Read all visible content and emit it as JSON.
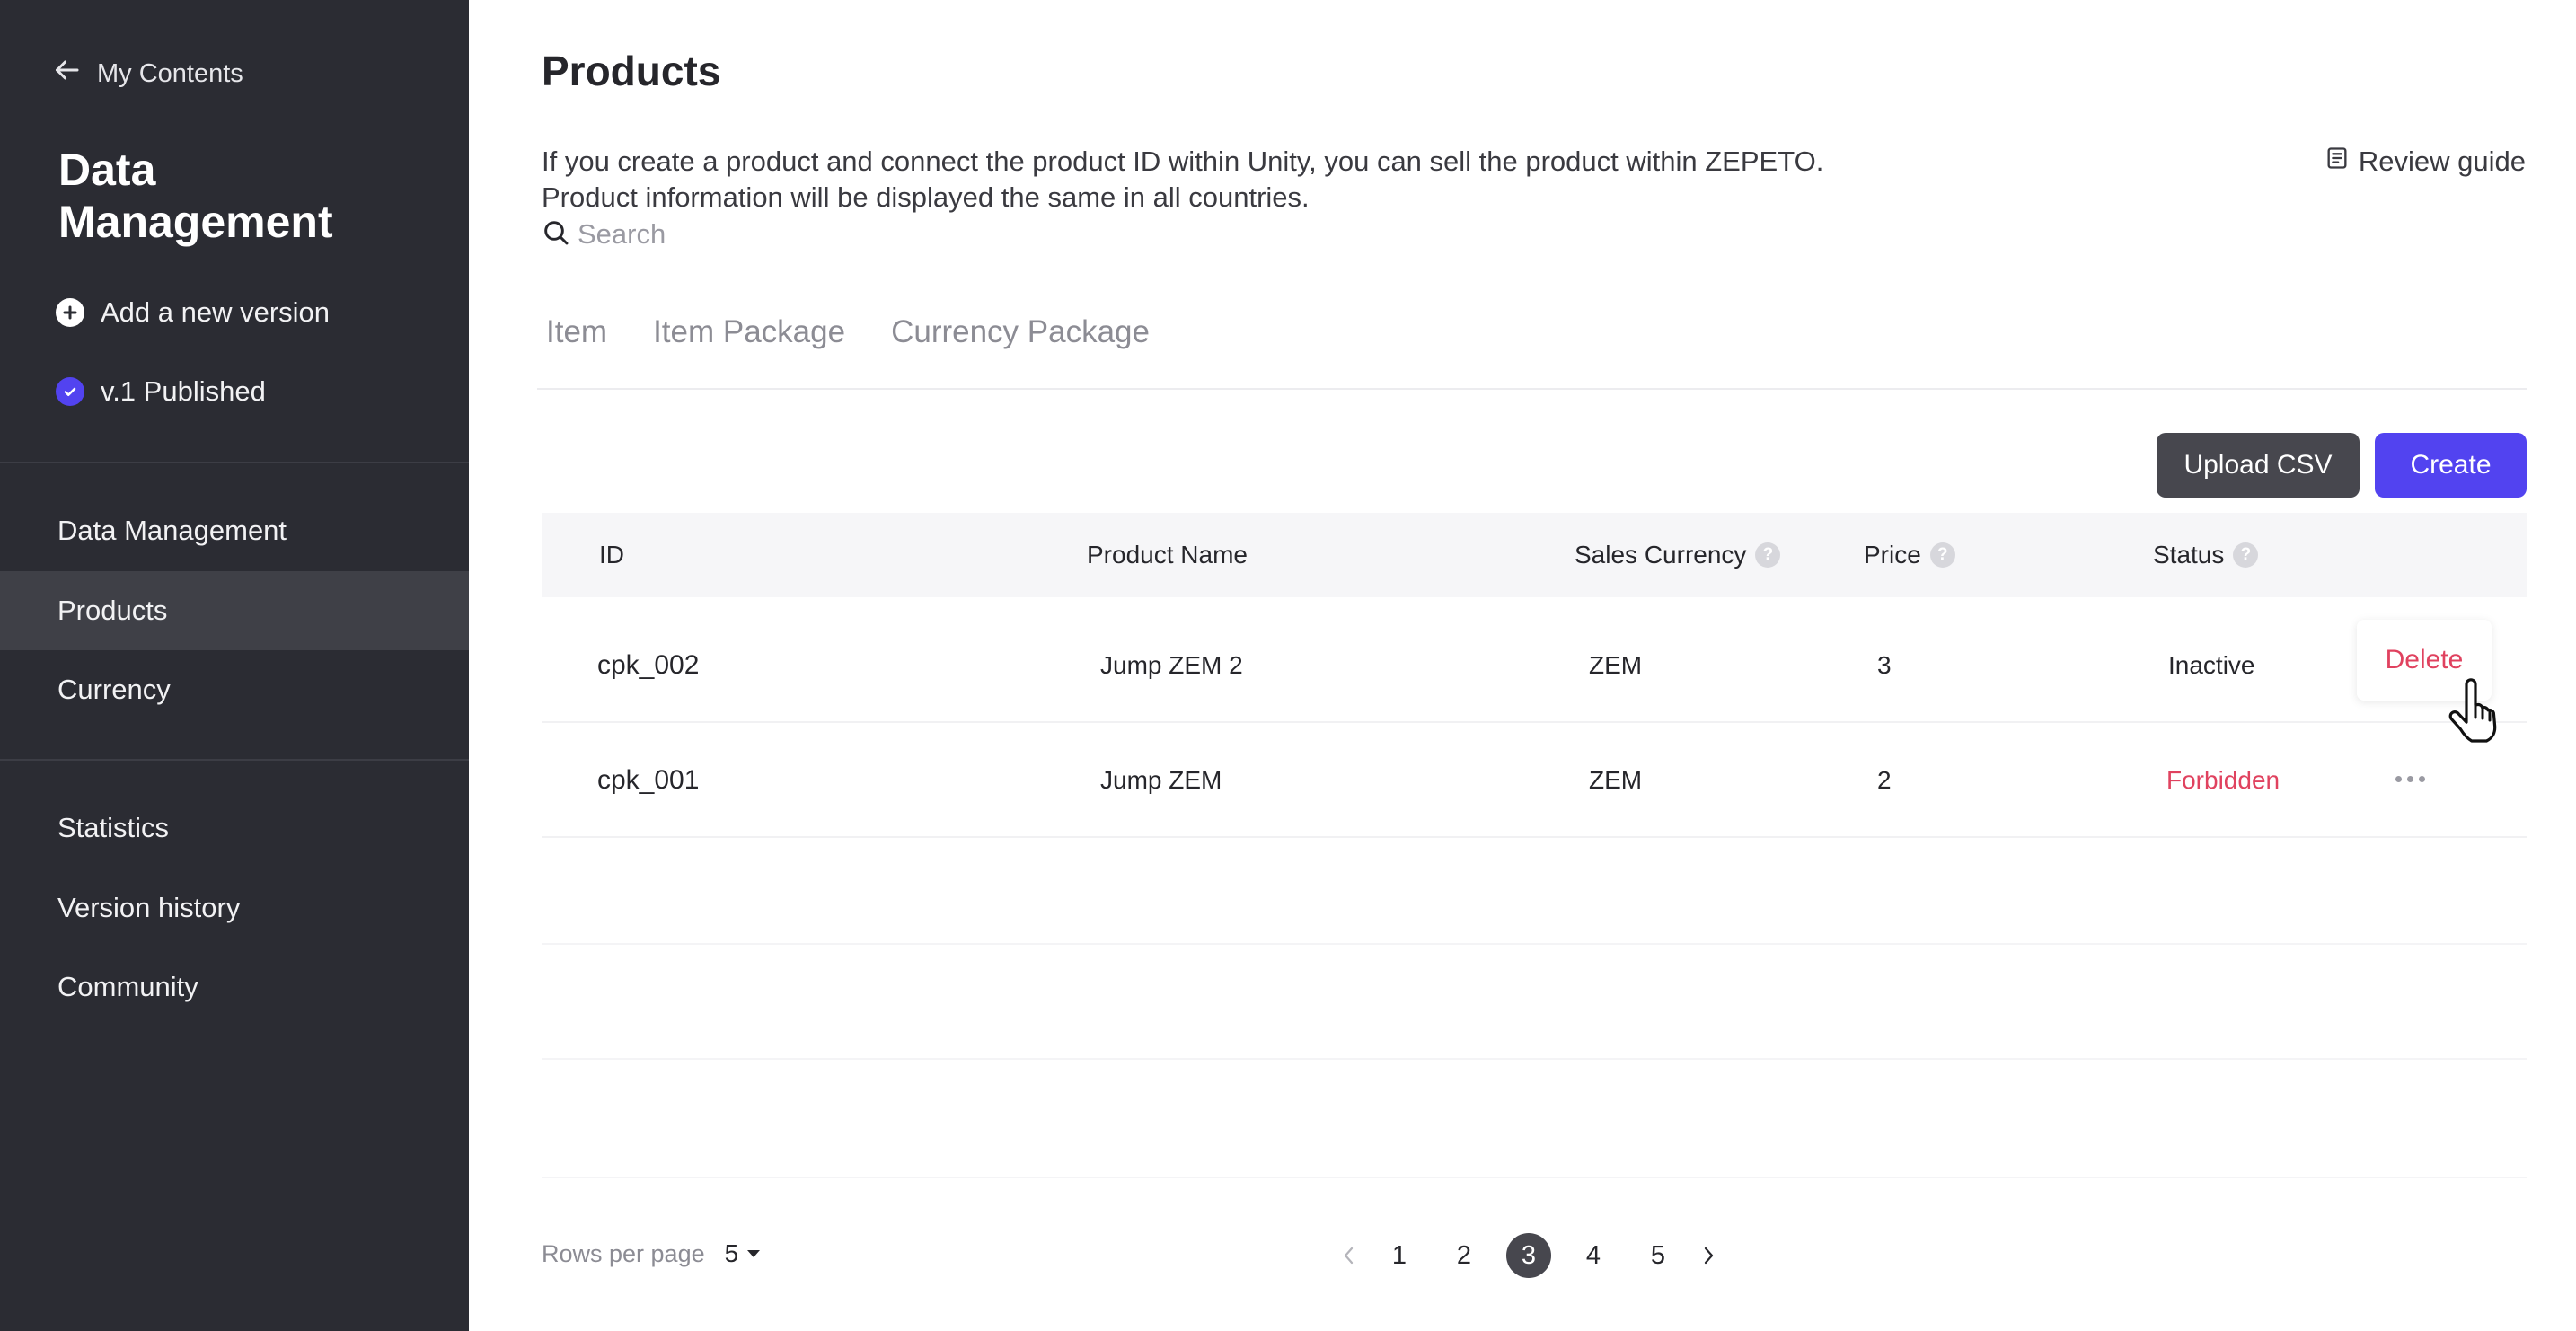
{
  "sidebar": {
    "back_label": "My Contents",
    "title": "Data Management",
    "add_version_label": "Add a new version",
    "published_label": "v.1 Published",
    "nav_primary": [
      {
        "label": "Data Management",
        "active": false
      },
      {
        "label": "Products",
        "active": true
      },
      {
        "label": "Currency",
        "active": false
      }
    ],
    "nav_secondary": [
      {
        "label": "Statistics"
      },
      {
        "label": "Version history"
      },
      {
        "label": "Community"
      }
    ]
  },
  "main": {
    "title": "Products",
    "description_line1": "If you create a product and connect the product ID within Unity, you can sell the product within ZEPETO.",
    "description_line2": "Product information will be displayed the same in all countries.",
    "review_guide_label": "Review guide",
    "search_placeholder": "Search",
    "tabs": [
      "Item",
      "Item Package",
      "Currency Package"
    ],
    "upload_csv_label": "Upload CSV",
    "create_label": "Create"
  },
  "table": {
    "headers": {
      "id": "ID",
      "product_name": "Product Name",
      "sales_currency": "Sales Currency",
      "price": "Price",
      "status": "Status"
    },
    "help_glyph": "?",
    "rows": [
      {
        "id": "cpk_002",
        "product_name": "Jump ZEM 2",
        "sales_currency": "ZEM",
        "price": "3",
        "status": "Inactive"
      },
      {
        "id": "cpk_001",
        "product_name": "Jump ZEM",
        "sales_currency": "ZEM",
        "price": "2",
        "status": "Forbidden"
      }
    ],
    "context_menu": {
      "delete_label": "Delete"
    }
  },
  "footer": {
    "rows_per_page_label": "Rows per page",
    "rows_per_page_value": "5",
    "pages": [
      "1",
      "2",
      "3",
      "4",
      "5"
    ],
    "current_page": "3"
  },
  "colors": {
    "sidebar_bg": "#2b2c33",
    "sidebar_active": "#3f4047",
    "accent": "#5243f0",
    "danger": "#e0425f",
    "dark_button": "#47474e"
  },
  "icons": {
    "back": "arrow-left-icon",
    "add": "plus-circle-icon",
    "published": "check-circle-icon",
    "review": "document-icon",
    "search": "search-icon",
    "help": "question-icon",
    "more": "more-dots-icon",
    "cursor": "hand-pointer-icon",
    "dropdown": "caret-down-icon",
    "prev": "chevron-left-icon",
    "next": "chevron-right-icon"
  }
}
